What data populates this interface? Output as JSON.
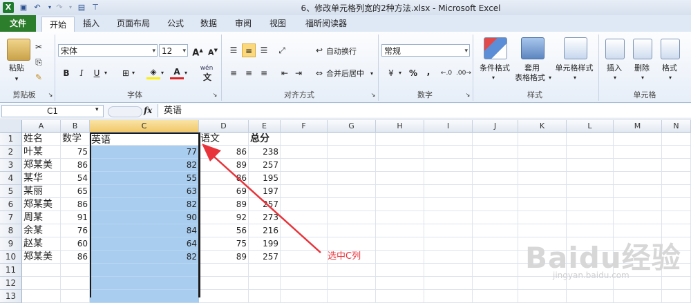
{
  "window": {
    "title": "6、修改单元格列宽的2种方法.xlsx - Microsoft Excel"
  },
  "tabs": {
    "file": "文件",
    "items": [
      "开始",
      "插入",
      "页面布局",
      "公式",
      "数据",
      "审阅",
      "视图",
      "福昕阅读器"
    ]
  },
  "ribbon": {
    "clipboard": {
      "label": "剪贴板",
      "paste": "粘贴"
    },
    "font": {
      "label": "字体",
      "name": "宋体",
      "size": "12",
      "bold": "B",
      "italic": "I",
      "underline": "U",
      "font_color_glyph": "A",
      "wen": "wén"
    },
    "align": {
      "label": "对齐方式",
      "wrap": "自动换行",
      "merge": "合并后居中"
    },
    "number": {
      "label": "数字",
      "format": "常规",
      "percent": "%",
      "comma": ","
    },
    "styles": {
      "label": "样式",
      "cond": "条件格式",
      "table1": "套用",
      "table2": "表格格式",
      "cell_style": "单元格样式"
    },
    "cells": {
      "label": "单元格",
      "insert": "插入",
      "delete": "删除",
      "format": "格式"
    }
  },
  "formula_bar": {
    "name_box": "C1",
    "fx": "fx",
    "content": "英语"
  },
  "grid": {
    "columns": [
      "A",
      "B",
      "C",
      "D",
      "E",
      "F",
      "G",
      "H",
      "I",
      "J",
      "K",
      "L",
      "M",
      "N"
    ],
    "rows": [
      "1",
      "2",
      "3",
      "4",
      "5",
      "6",
      "7",
      "8",
      "9",
      "10",
      "11",
      "12",
      "13"
    ],
    "selected_column": "C",
    "data": [
      [
        "姓名",
        "数学",
        "英语",
        "语文",
        "总分"
      ],
      [
        "叶某",
        "75",
        "77",
        "86",
        "238"
      ],
      [
        "郑某美",
        "86",
        "82",
        "89",
        "257"
      ],
      [
        "某华",
        "54",
        "55",
        "86",
        "195"
      ],
      [
        "某丽",
        "65",
        "63",
        "69",
        "197"
      ],
      [
        "郑某美",
        "86",
        "82",
        "89",
        "257"
      ],
      [
        "周某",
        "91",
        "90",
        "92",
        "273"
      ],
      [
        "余某",
        "76",
        "84",
        "56",
        "216"
      ],
      [
        "赵某",
        "60",
        "64",
        "75",
        "199"
      ],
      [
        "郑某美",
        "86",
        "82",
        "89",
        "257"
      ]
    ]
  },
  "annotation": {
    "text": "选中C列",
    "color": "#e8333a"
  },
  "watermark": {
    "text": "Baidu经验",
    "sub": "jingyan.baidu.com"
  }
}
